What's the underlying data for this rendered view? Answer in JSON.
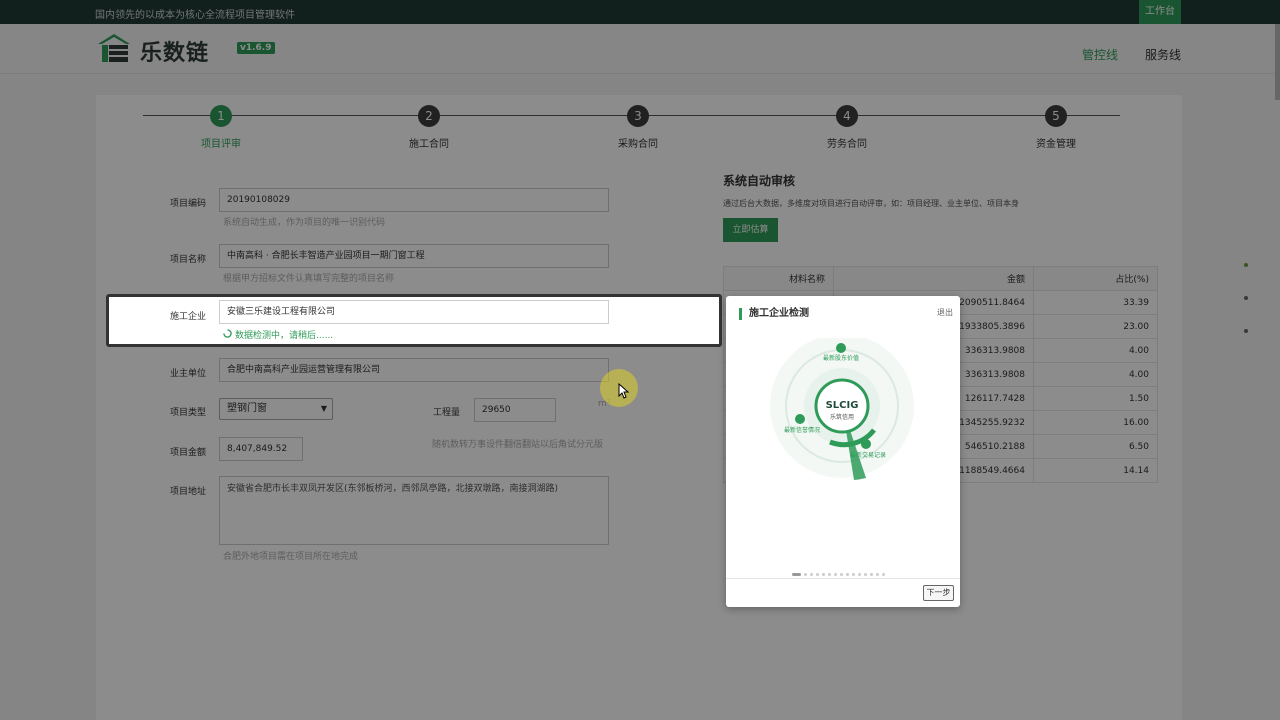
{
  "topbar": {
    "slogan": "国内领先的以成本为核心全流程项目管理软件",
    "workbench": "工作台"
  },
  "header": {
    "logo_text": "乐数链",
    "version": "v1.6.9",
    "nav": [
      "管控线",
      "服务线"
    ]
  },
  "steps": [
    {
      "num": "1",
      "label": "项目评审"
    },
    {
      "num": "2",
      "label": "施工合同"
    },
    {
      "num": "3",
      "label": "采购合同"
    },
    {
      "num": "4",
      "label": "劳务合同"
    },
    {
      "num": "5",
      "label": "资金管理"
    }
  ],
  "form": {
    "code_label": "项目编码",
    "code_value": "20190108029",
    "code_hint": "系统自动生成，作为项目的唯一识别代码",
    "name_label": "项目名称",
    "name_value": "中南高科 · 合肥长丰智造产业园项目一期门窗工程",
    "name_hint": "根据甲方招标文件认真填写完整的项目名称",
    "company_label": "施工企业",
    "company_value": "安徽三乐建设工程有限公司",
    "company_status": "数据检测中，请稍后......",
    "owner_label": "业主单位",
    "owner_value": "合肥中南高科产业园运营管理有限公司",
    "type_label": "项目类型",
    "type_value": "塑钢门窗",
    "quantity_label": "工程量",
    "quantity_value": "29650",
    "quantity_unit": "m²",
    "amount_label": "项目金额",
    "amount_value": "8,407,849.52",
    "amount_hint": "随机数转万事设件翻倍翻站以后角试分元版",
    "address_label": "项目地址",
    "address_value": "安徽省合肥市长丰双凤开发区(东邻板桥河，西邻凤亭路，北接双墩路，南接洞湖路)",
    "address_hint": "合肥外地项目需在项目所在地完成"
  },
  "audit": {
    "title": "系统自动审核",
    "desc": "通过后台大数据，多维度对项目进行自动评审，如：项目经理、业主单位、项目本身",
    "estimate_button": "立即估算",
    "table_headers": [
      "材料名称",
      "金额",
      "占比(%)"
    ],
    "rows": [
      [
        "",
        "2090511.8464",
        "33.39"
      ],
      [
        "",
        "1933805.3896",
        "23.00"
      ],
      [
        "",
        "336313.9808",
        "4.00"
      ],
      [
        "",
        "336313.9808",
        "4.00"
      ],
      [
        "",
        "126117.7428",
        "1.50"
      ],
      [
        "",
        "1345255.9232",
        "16.00"
      ],
      [
        "",
        "546510.2188",
        "6.50"
      ],
      [
        "",
        "1188549.4664",
        "14.14"
      ]
    ]
  },
  "popup": {
    "title": "施工企业检测",
    "close": "退出",
    "logo_text": "SLCIG",
    "logo_sub": "乐筑信用",
    "label_top": "最新股东价值",
    "label_left": "最新信誉情况",
    "label_right": "最新交易记录",
    "next": "下一步",
    "page_count": 15,
    "current_page": 1
  },
  "colors": {
    "accent": "#2e9b58",
    "topbar": "#1f3a35"
  }
}
